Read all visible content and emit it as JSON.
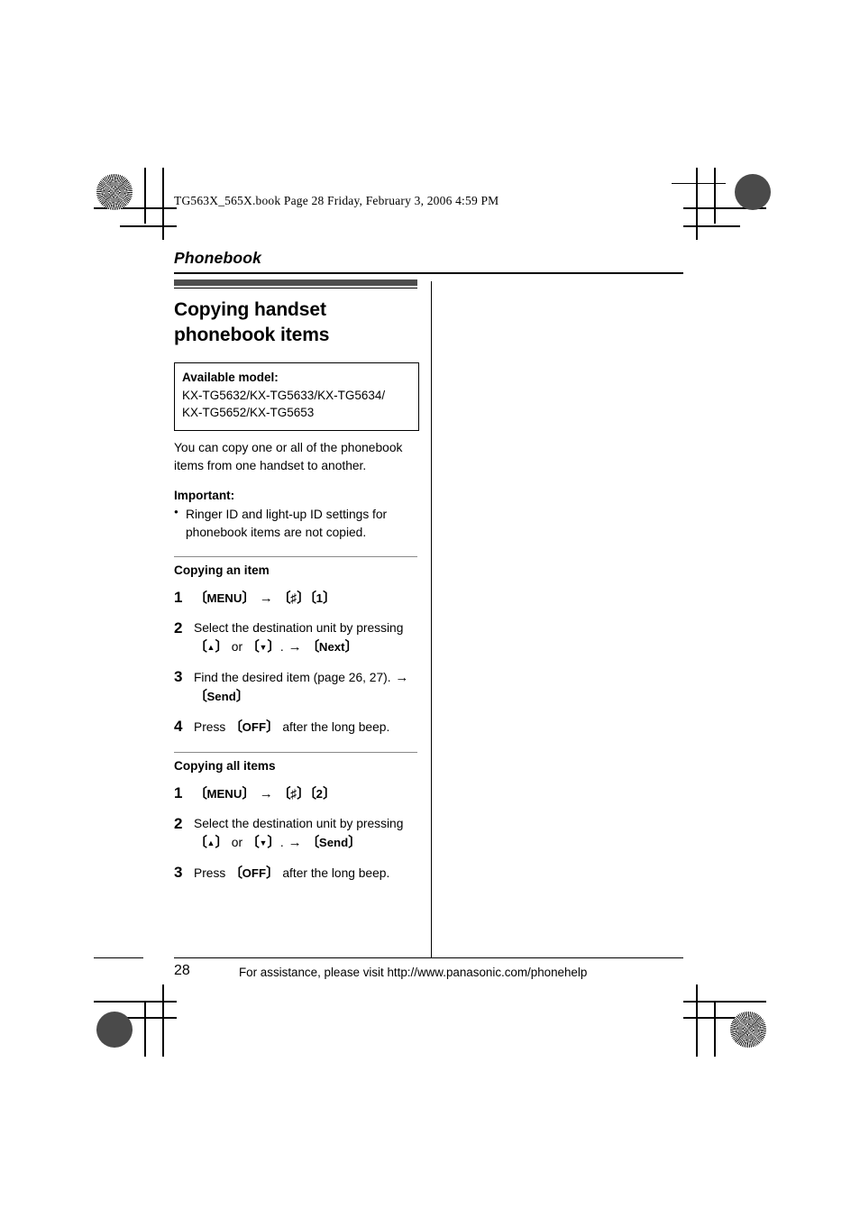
{
  "page": {
    "filename_line": "TG563X_565X.book  Page 28  Friday, February 3, 2006  4:59 PM",
    "chapter": "Phonebook",
    "folio": "28",
    "footer_text": "For assistance, please visit http://www.panasonic.com/phonehelp"
  },
  "section": {
    "title_line1": "Copying handset",
    "title_line2": "phonebook items",
    "model_box": {
      "label": "Available model:",
      "models_line1": "KX-TG5632/KX-TG5633/KX-TG5634/",
      "models_line2": "KX-TG5652/KX-TG5653"
    },
    "intro": "You can copy one or all of the phonebook items from one handset to another.",
    "important_label": "Important:",
    "important_bullets": [
      "Ringer ID and light-up ID settings for phonebook items are not copied."
    ]
  },
  "copying_an_item": {
    "heading": "Copying an item",
    "steps": [
      {
        "num": "1",
        "parts": [
          {
            "type": "key",
            "text": "MENU"
          },
          {
            "type": "arrow",
            "text": "→"
          },
          {
            "type": "key",
            "text": "♯"
          },
          {
            "type": "key",
            "text": "1"
          }
        ],
        "plain": "[MENU] → [♯][1]"
      },
      {
        "num": "2",
        "text_before": "Select the destination unit by pressing",
        "parts": [
          {
            "type": "key",
            "text": "▲"
          },
          {
            "type": "text",
            "text": "or"
          },
          {
            "type": "key",
            "text": "▼"
          },
          {
            "type": "text",
            "text": "."
          },
          {
            "type": "arrow",
            "text": "→"
          },
          {
            "type": "key",
            "text": "Next"
          }
        ],
        "plain": "Select the destination unit by pressing [▲] or [▼]. → [Next]"
      },
      {
        "num": "3",
        "text_before": "Find the desired item (page 26, 27).",
        "parts": [
          {
            "type": "arrow",
            "text": "→"
          },
          {
            "type": "key",
            "text": "Send"
          }
        ],
        "plain": "Find the desired item (page 26, 27). → [Send]"
      },
      {
        "num": "4",
        "text_before": "Press",
        "parts": [
          {
            "type": "key",
            "text": "OFF"
          },
          {
            "type": "text",
            "text": "after the long beep."
          }
        ],
        "plain": "Press [OFF] after the long beep."
      }
    ]
  },
  "copying_all_items": {
    "heading": "Copying all items",
    "steps": [
      {
        "num": "1",
        "plain": "[MENU] → [♯][2]"
      },
      {
        "num": "2",
        "text_before": "Select the destination unit by pressing",
        "plain": "Select the destination unit by pressing [▲] or [▼]. → [Send]"
      },
      {
        "num": "3",
        "text_before": "Press",
        "plain": "Press [OFF] after the long beep."
      }
    ]
  },
  "labels": {
    "key_menu": "MENU",
    "key_next": "Next",
    "key_send": "Send",
    "key_off": "OFF",
    "key_sharp": "♯",
    "key_one": "1",
    "key_two": "2",
    "key_up": "▲",
    "key_down": "▼",
    "arrow": "→",
    "word_or": "or",
    "period": ".",
    "press": "Press",
    "after_beep": "after the long beep.",
    "select_destination": "Select the destination unit by pressing",
    "find_item": "Find the desired item (page 26, 27)."
  },
  "colors": {
    "title_bar": "#4d4d4d",
    "rule": "#000000",
    "sub_rule": "#8a8a8a"
  }
}
